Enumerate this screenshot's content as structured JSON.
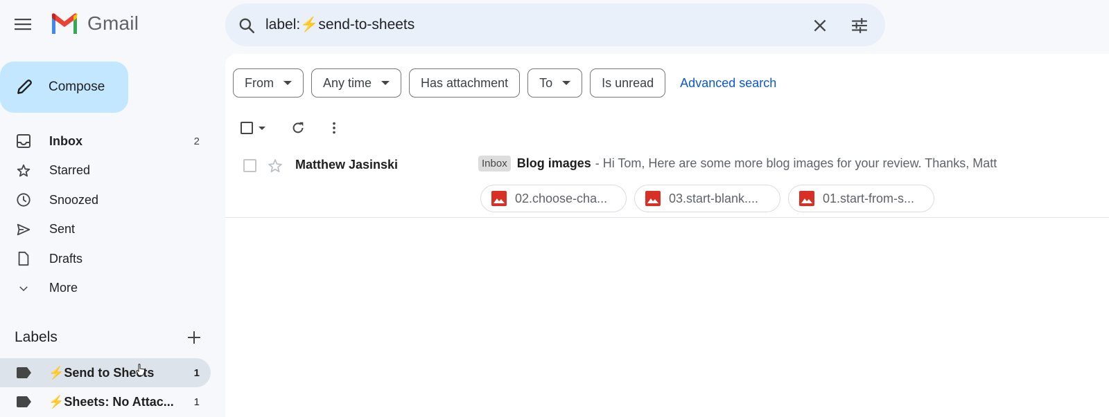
{
  "app": {
    "name": "Gmail",
    "logo_colors": [
      "#4285f4",
      "#ea4335",
      "#fbbc04",
      "#34a853",
      "#c5221f"
    ]
  },
  "search": {
    "query": "label:⚡send-to-sheets",
    "icons": [
      "search-icon",
      "close-icon",
      "tune-icon"
    ]
  },
  "compose": {
    "label": "Compose"
  },
  "nav": {
    "items": [
      {
        "label": "Inbox",
        "icon": "inbox-icon",
        "count": "2",
        "bold": true
      },
      {
        "label": "Starred",
        "icon": "star-icon",
        "count": ""
      },
      {
        "label": "Snoozed",
        "icon": "clock-icon",
        "count": ""
      },
      {
        "label": "Sent",
        "icon": "send-icon",
        "count": ""
      },
      {
        "label": "Drafts",
        "icon": "draft-icon",
        "count": ""
      },
      {
        "label": "More",
        "icon": "chevron-down-icon",
        "count": ""
      }
    ]
  },
  "labels": {
    "header": "Labels",
    "items": [
      {
        "name": "⚡Send to Sheets",
        "count": "1",
        "active": true
      },
      {
        "name": "⚡Sheets: No Attac...",
        "count": "1",
        "active": false
      }
    ]
  },
  "filters": {
    "chips": [
      {
        "label": "From",
        "dropdown": true
      },
      {
        "label": "Any time",
        "dropdown": true
      },
      {
        "label": "Has attachment",
        "dropdown": false
      },
      {
        "label": "To",
        "dropdown": true
      },
      {
        "label": "Is unread",
        "dropdown": false
      }
    ],
    "advanced_search": "Advanced search"
  },
  "emails": [
    {
      "sender": "Matthew Jasinski",
      "badge": "Inbox",
      "subject": "Blog images",
      "snippet": "- Hi Tom, Here are some more blog images for your review. Thanks, Matt",
      "starred": false,
      "attachments": [
        {
          "name": "02.choose-cha..."
        },
        {
          "name": "03.start-blank...."
        },
        {
          "name": "01.start-from-s..."
        }
      ]
    }
  ],
  "colors": {
    "compose_bg": "#c2e7ff",
    "search_bg": "#e9f0fa",
    "active_label_bg": "#dde3ea",
    "link": "#0b57d0",
    "attachment_icon": "#d93025",
    "bolt": "#f4b400"
  }
}
